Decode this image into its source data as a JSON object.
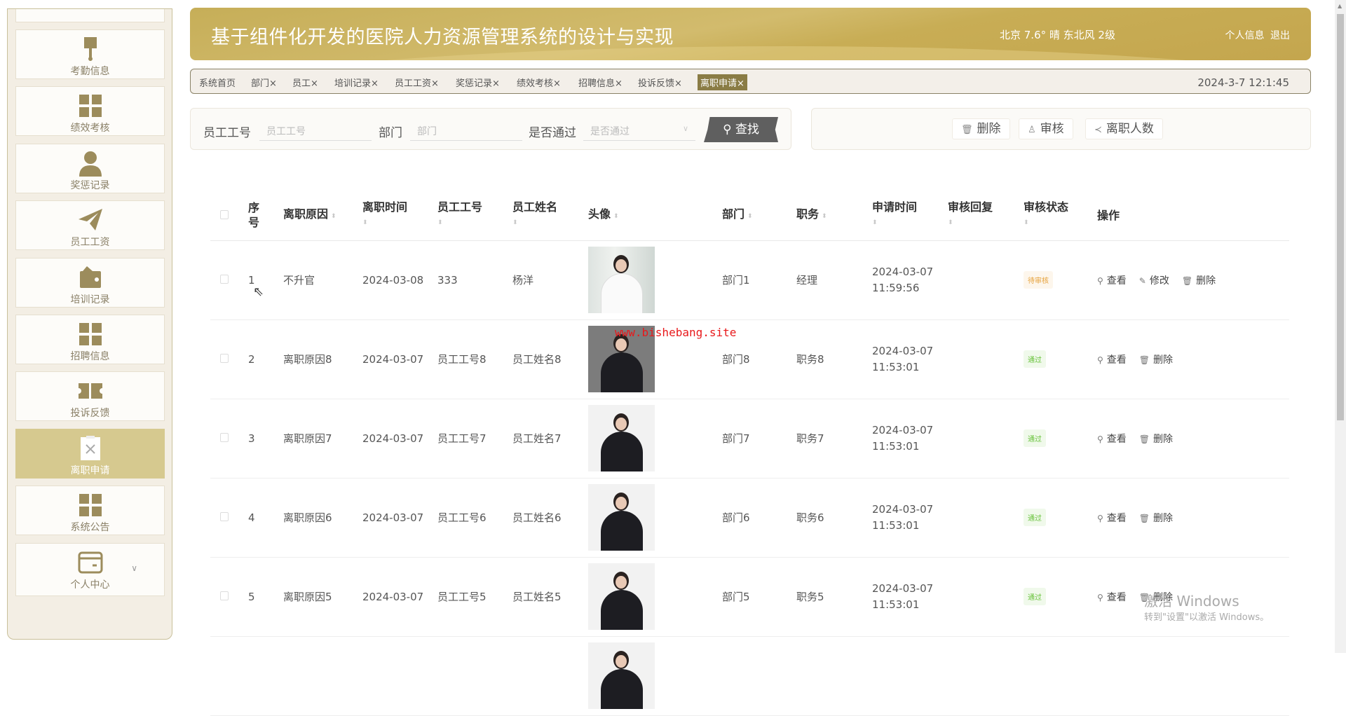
{
  "sidebar": {
    "items": [
      {
        "label": "考勤信息",
        "icon": "brush-icon"
      },
      {
        "label": "绩效考核",
        "icon": "grid-icon"
      },
      {
        "label": "奖惩记录",
        "icon": "user-icon"
      },
      {
        "label": "员工工资",
        "icon": "paper-plane-icon"
      },
      {
        "label": "培训记录",
        "icon": "wallet-icon"
      },
      {
        "label": "招聘信息",
        "icon": "grid-icon"
      },
      {
        "label": "投诉反馈",
        "icon": "ticket-icon"
      },
      {
        "label": "离职申请",
        "icon": "clipboard-x-icon",
        "active": true
      },
      {
        "label": "系统公告",
        "icon": "grid-icon"
      },
      {
        "label": "个人中心",
        "icon": "card-icon"
      }
    ]
  },
  "header": {
    "title": "基于组件化开发的医院人力资源管理系统的设计与实现",
    "weather": "北京 7.6° 晴 东北风 2级",
    "profile": "个人信息",
    "logout": "退出"
  },
  "tabs": {
    "items": [
      "系统首页",
      "部门×",
      "员工×",
      "培训记录×",
      "员工工资×",
      "奖惩记录×",
      "绩效考核×",
      "招聘信息×",
      "投诉反馈×",
      "离职申请×"
    ],
    "clock": "2024-3-7 12:1:45"
  },
  "search": {
    "emp_no_label": "员工工号",
    "emp_no_placeholder": "员工工号",
    "dept_label": "部门",
    "dept_placeholder": "部门",
    "pass_label": "是否通过",
    "pass_placeholder": "是否通过",
    "find": "查找"
  },
  "actions": {
    "delete": "删除",
    "audit": "审核",
    "count": "离职人数"
  },
  "table": {
    "headers": [
      "序号",
      "离职原因",
      "离职时间",
      "员工工号",
      "员工姓名",
      "头像",
      "部门",
      "职务",
      "申请时间",
      "审核回复",
      "审核状态",
      "操作"
    ],
    "ops": {
      "view": "查看",
      "edit": "修改",
      "delete": "删除"
    },
    "rows": [
      {
        "no": "1",
        "reason": "不升官",
        "time": "2024-03-08",
        "emp_no": "333",
        "name": "杨洋",
        "dept": "部门1",
        "job": "经理",
        "apply_date": "2024-03-07",
        "apply_time": "11:59:56",
        "reply": "",
        "status": "待审核"
      },
      {
        "no": "2",
        "reason": "离职原因8",
        "time": "2024-03-07",
        "emp_no": "员工工号8",
        "name": "员工姓名8",
        "dept": "部门8",
        "job": "职务8",
        "apply_date": "2024-03-07",
        "apply_time": "11:53:01",
        "reply": "",
        "status": "通过"
      },
      {
        "no": "3",
        "reason": "离职原因7",
        "time": "2024-03-07",
        "emp_no": "员工工号7",
        "name": "员工姓名7",
        "dept": "部门7",
        "job": "职务7",
        "apply_date": "2024-03-07",
        "apply_time": "11:53:01",
        "reply": "",
        "status": "通过"
      },
      {
        "no": "4",
        "reason": "离职原因6",
        "time": "2024-03-07",
        "emp_no": "员工工号6",
        "name": "员工姓名6",
        "dept": "部门6",
        "job": "职务6",
        "apply_date": "2024-03-07",
        "apply_time": "11:53:01",
        "reply": "",
        "status": "通过"
      },
      {
        "no": "5",
        "reason": "离职原因5",
        "time": "2024-03-07",
        "emp_no": "员工工号5",
        "name": "员工姓名5",
        "dept": "部门5",
        "job": "职务5",
        "apply_date": "2024-03-07",
        "apply_time": "11:53:01",
        "reply": "",
        "status": "通过"
      }
    ]
  },
  "watermark": "www.bishebang.site",
  "windows": {
    "line1": "激活 Windows",
    "line2": "转到\"设置\"以激活 Windows。"
  },
  "colors": {
    "accent": "#c6ae58",
    "active_tab": "#8a7c45",
    "pending": "#e6a23c",
    "pass": "#67c23a"
  }
}
